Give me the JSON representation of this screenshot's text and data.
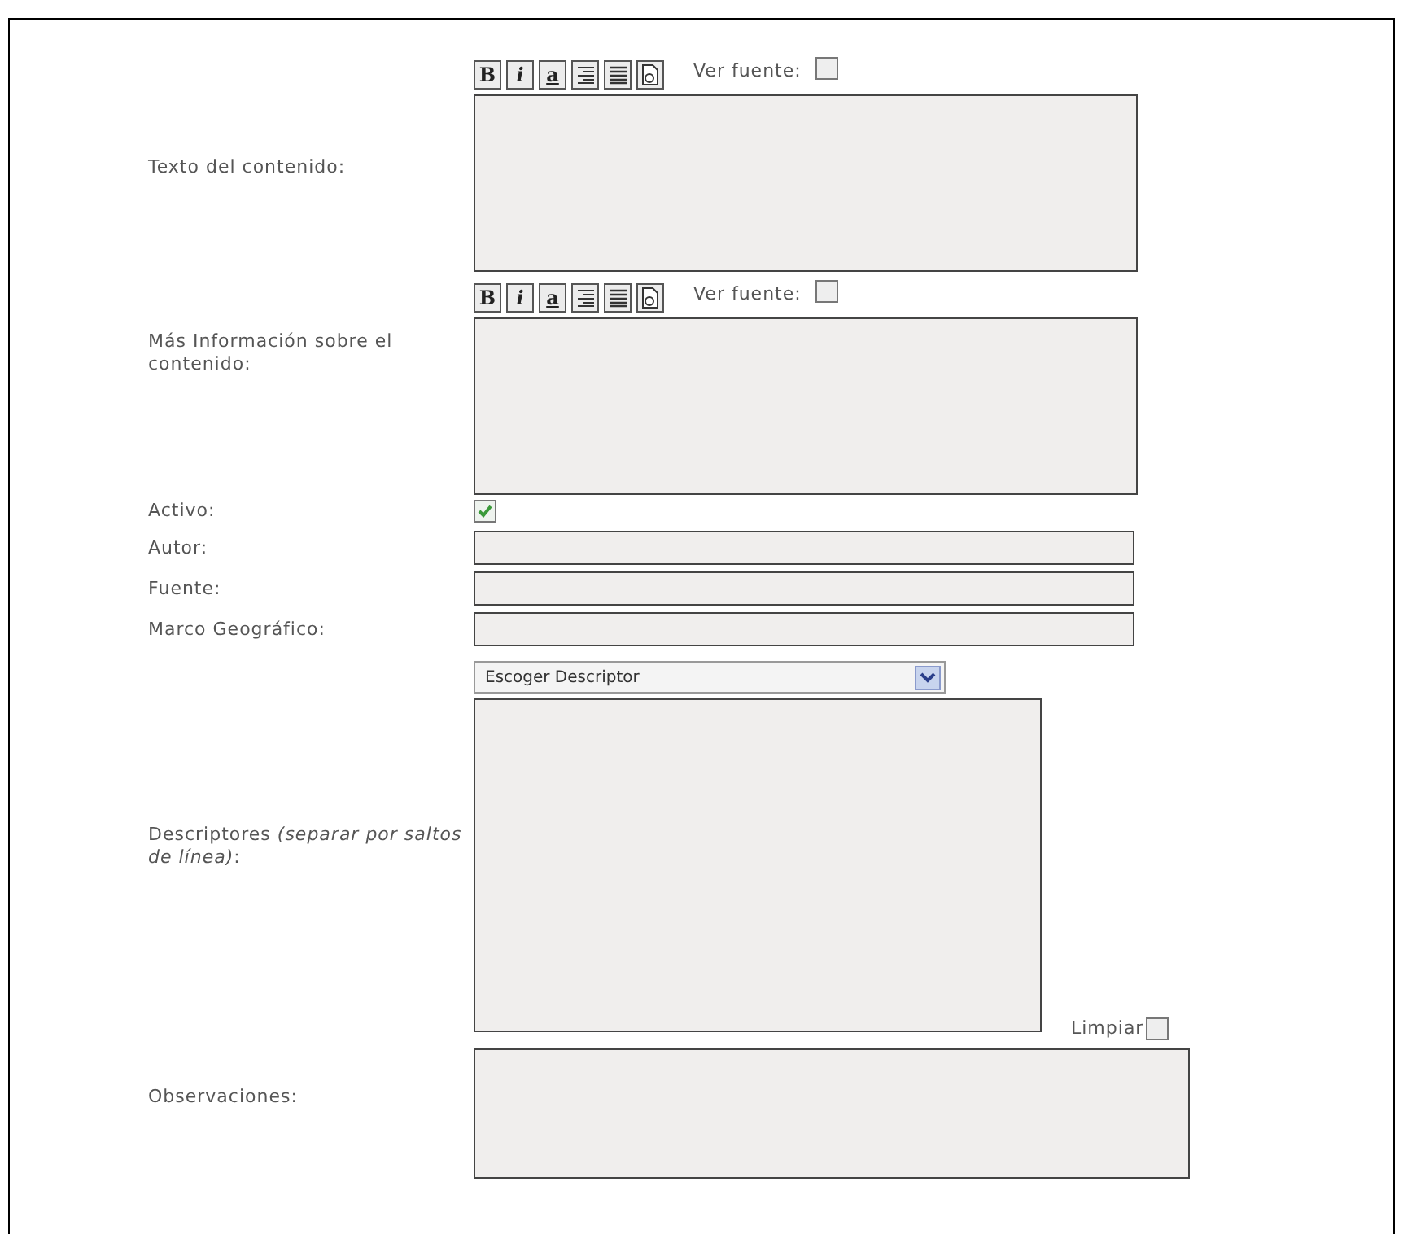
{
  "editors": [
    {
      "label": "Texto del contenido:",
      "toolbar": [
        {
          "kind": "bold",
          "text": "B"
        },
        {
          "kind": "italic",
          "text": "i"
        },
        {
          "kind": "underline",
          "text": "a"
        },
        {
          "kind": "align"
        },
        {
          "kind": "justify"
        },
        {
          "kind": "source"
        }
      ],
      "source_label": "Ver fuente:",
      "source_checked": false
    },
    {
      "label": "Más Información sobre el contenido:",
      "toolbar": [
        {
          "kind": "bold",
          "text": "B"
        },
        {
          "kind": "italic",
          "text": "i"
        },
        {
          "kind": "underline",
          "text": "a"
        },
        {
          "kind": "align"
        },
        {
          "kind": "justify"
        },
        {
          "kind": "source"
        }
      ],
      "source_label": "Ver fuente:",
      "source_checked": false
    }
  ],
  "active": {
    "label": "Activo:",
    "checked": true
  },
  "fields": [
    {
      "label": "Autor:"
    },
    {
      "label": "Fuente:"
    },
    {
      "label": "Marco Geográfico:"
    }
  ],
  "descriptors": {
    "label": "Descriptores *(separar por saltos de línea)*:",
    "select": "Escoger Descriptor",
    "clear_label": "Limpiar",
    "clear_checked": false
  },
  "observations": {
    "label": "Observaciones:"
  }
}
